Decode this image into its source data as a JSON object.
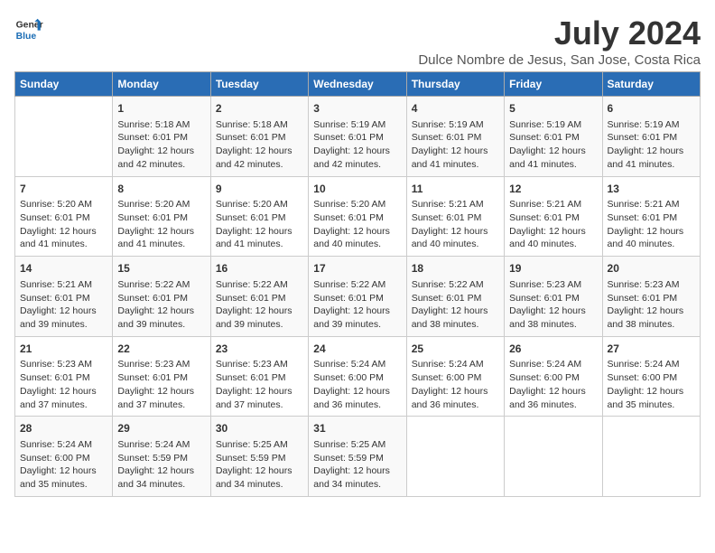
{
  "logo": {
    "line1": "General",
    "line2": "Blue"
  },
  "title": "July 2024",
  "subtitle": "Dulce Nombre de Jesus, San Jose, Costa Rica",
  "header": {
    "days": [
      "Sunday",
      "Monday",
      "Tuesday",
      "Wednesday",
      "Thursday",
      "Friday",
      "Saturday"
    ]
  },
  "weeks": [
    {
      "cells": [
        {
          "day": "",
          "info": ""
        },
        {
          "day": "1",
          "info": "Sunrise: 5:18 AM\nSunset: 6:01 PM\nDaylight: 12 hours\nand 42 minutes."
        },
        {
          "day": "2",
          "info": "Sunrise: 5:18 AM\nSunset: 6:01 PM\nDaylight: 12 hours\nand 42 minutes."
        },
        {
          "day": "3",
          "info": "Sunrise: 5:19 AM\nSunset: 6:01 PM\nDaylight: 12 hours\nand 42 minutes."
        },
        {
          "day": "4",
          "info": "Sunrise: 5:19 AM\nSunset: 6:01 PM\nDaylight: 12 hours\nand 41 minutes."
        },
        {
          "day": "5",
          "info": "Sunrise: 5:19 AM\nSunset: 6:01 PM\nDaylight: 12 hours\nand 41 minutes."
        },
        {
          "day": "6",
          "info": "Sunrise: 5:19 AM\nSunset: 6:01 PM\nDaylight: 12 hours\nand 41 minutes."
        }
      ]
    },
    {
      "cells": [
        {
          "day": "7",
          "info": "Sunrise: 5:20 AM\nSunset: 6:01 PM\nDaylight: 12 hours\nand 41 minutes."
        },
        {
          "day": "8",
          "info": "Sunrise: 5:20 AM\nSunset: 6:01 PM\nDaylight: 12 hours\nand 41 minutes."
        },
        {
          "day": "9",
          "info": "Sunrise: 5:20 AM\nSunset: 6:01 PM\nDaylight: 12 hours\nand 41 minutes."
        },
        {
          "day": "10",
          "info": "Sunrise: 5:20 AM\nSunset: 6:01 PM\nDaylight: 12 hours\nand 40 minutes."
        },
        {
          "day": "11",
          "info": "Sunrise: 5:21 AM\nSunset: 6:01 PM\nDaylight: 12 hours\nand 40 minutes."
        },
        {
          "day": "12",
          "info": "Sunrise: 5:21 AM\nSunset: 6:01 PM\nDaylight: 12 hours\nand 40 minutes."
        },
        {
          "day": "13",
          "info": "Sunrise: 5:21 AM\nSunset: 6:01 PM\nDaylight: 12 hours\nand 40 minutes."
        }
      ]
    },
    {
      "cells": [
        {
          "day": "14",
          "info": "Sunrise: 5:21 AM\nSunset: 6:01 PM\nDaylight: 12 hours\nand 39 minutes."
        },
        {
          "day": "15",
          "info": "Sunrise: 5:22 AM\nSunset: 6:01 PM\nDaylight: 12 hours\nand 39 minutes."
        },
        {
          "day": "16",
          "info": "Sunrise: 5:22 AM\nSunset: 6:01 PM\nDaylight: 12 hours\nand 39 minutes."
        },
        {
          "day": "17",
          "info": "Sunrise: 5:22 AM\nSunset: 6:01 PM\nDaylight: 12 hours\nand 39 minutes."
        },
        {
          "day": "18",
          "info": "Sunrise: 5:22 AM\nSunset: 6:01 PM\nDaylight: 12 hours\nand 38 minutes."
        },
        {
          "day": "19",
          "info": "Sunrise: 5:23 AM\nSunset: 6:01 PM\nDaylight: 12 hours\nand 38 minutes."
        },
        {
          "day": "20",
          "info": "Sunrise: 5:23 AM\nSunset: 6:01 PM\nDaylight: 12 hours\nand 38 minutes."
        }
      ]
    },
    {
      "cells": [
        {
          "day": "21",
          "info": "Sunrise: 5:23 AM\nSunset: 6:01 PM\nDaylight: 12 hours\nand 37 minutes."
        },
        {
          "day": "22",
          "info": "Sunrise: 5:23 AM\nSunset: 6:01 PM\nDaylight: 12 hours\nand 37 minutes."
        },
        {
          "day": "23",
          "info": "Sunrise: 5:23 AM\nSunset: 6:01 PM\nDaylight: 12 hours\nand 37 minutes."
        },
        {
          "day": "24",
          "info": "Sunrise: 5:24 AM\nSunset: 6:00 PM\nDaylight: 12 hours\nand 36 minutes."
        },
        {
          "day": "25",
          "info": "Sunrise: 5:24 AM\nSunset: 6:00 PM\nDaylight: 12 hours\nand 36 minutes."
        },
        {
          "day": "26",
          "info": "Sunrise: 5:24 AM\nSunset: 6:00 PM\nDaylight: 12 hours\nand 36 minutes."
        },
        {
          "day": "27",
          "info": "Sunrise: 5:24 AM\nSunset: 6:00 PM\nDaylight: 12 hours\nand 35 minutes."
        }
      ]
    },
    {
      "cells": [
        {
          "day": "28",
          "info": "Sunrise: 5:24 AM\nSunset: 6:00 PM\nDaylight: 12 hours\nand 35 minutes."
        },
        {
          "day": "29",
          "info": "Sunrise: 5:24 AM\nSunset: 5:59 PM\nDaylight: 12 hours\nand 34 minutes."
        },
        {
          "day": "30",
          "info": "Sunrise: 5:25 AM\nSunset: 5:59 PM\nDaylight: 12 hours\nand 34 minutes."
        },
        {
          "day": "31",
          "info": "Sunrise: 5:25 AM\nSunset: 5:59 PM\nDaylight: 12 hours\nand 34 minutes."
        },
        {
          "day": "",
          "info": ""
        },
        {
          "day": "",
          "info": ""
        },
        {
          "day": "",
          "info": ""
        }
      ]
    }
  ]
}
